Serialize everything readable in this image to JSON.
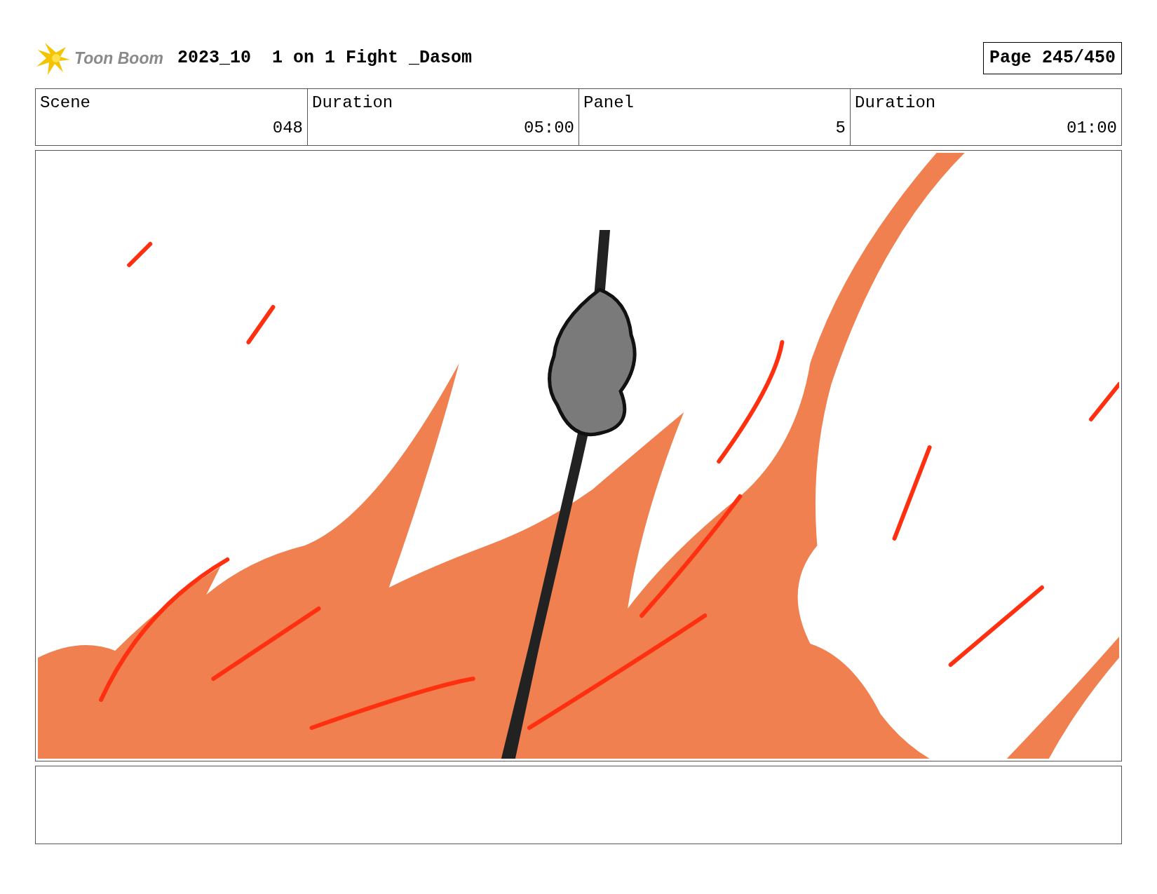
{
  "header": {
    "logo_text": "Toon Boom",
    "title": "2023_10  1 on 1 Fight _Dasom",
    "page": "Page 245/450"
  },
  "info_table": {
    "columns": [
      "Scene",
      "Duration",
      "Panel",
      "Duration"
    ],
    "values": [
      "048",
      "05:00",
      "5",
      "01:00"
    ]
  }
}
